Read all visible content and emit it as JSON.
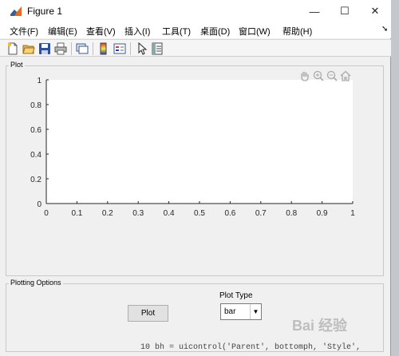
{
  "window": {
    "title": "Figure 1"
  },
  "window_controls": {
    "minimize": "—",
    "maximize": "☐",
    "close": "✕"
  },
  "menubar": {
    "items": [
      "文件(F)",
      "编辑(E)",
      "查看(V)",
      "插入(I)",
      "工具(T)",
      "桌面(D)",
      "窗口(W)",
      "帮助(H)"
    ],
    "overflow_arrow": "➘"
  },
  "toolbar": {
    "icons": [
      "new-file-icon",
      "open-folder-icon",
      "save-icon",
      "print-icon",
      "link-figure-icon",
      "colorbar-icon",
      "legend-icon",
      "pointer-icon",
      "property-inspector-icon"
    ]
  },
  "plot_panel": {
    "title": "Plot",
    "tools": [
      "pan-hand-icon",
      "zoom-in-icon",
      "zoom-out-icon",
      "home-icon"
    ]
  },
  "chart_data": {
    "type": "line",
    "series": [],
    "xlim": [
      0,
      1
    ],
    "ylim": [
      0,
      1
    ],
    "xticks": [
      "0",
      "0.1",
      "0.2",
      "0.3",
      "0.4",
      "0.5",
      "0.6",
      "0.7",
      "0.8",
      "0.9",
      "1"
    ],
    "yticks": [
      "0",
      "0.2",
      "0.4",
      "0.6",
      "0.8",
      "1"
    ],
    "grid": false
  },
  "options_panel": {
    "title": "Plotting Options",
    "plot_button": "Plot",
    "plot_type_label": "Plot Type",
    "plot_type_selected": "bar"
  },
  "background": {
    "code_line": "10      bh = uicontrol('Parent', bottomph, 'Style',",
    "watermark": "Bai 经验"
  },
  "colors": {
    "accent": "#1e5aa8",
    "axes_bg": "#ffffff",
    "panel_bg": "#f0f0f0"
  }
}
